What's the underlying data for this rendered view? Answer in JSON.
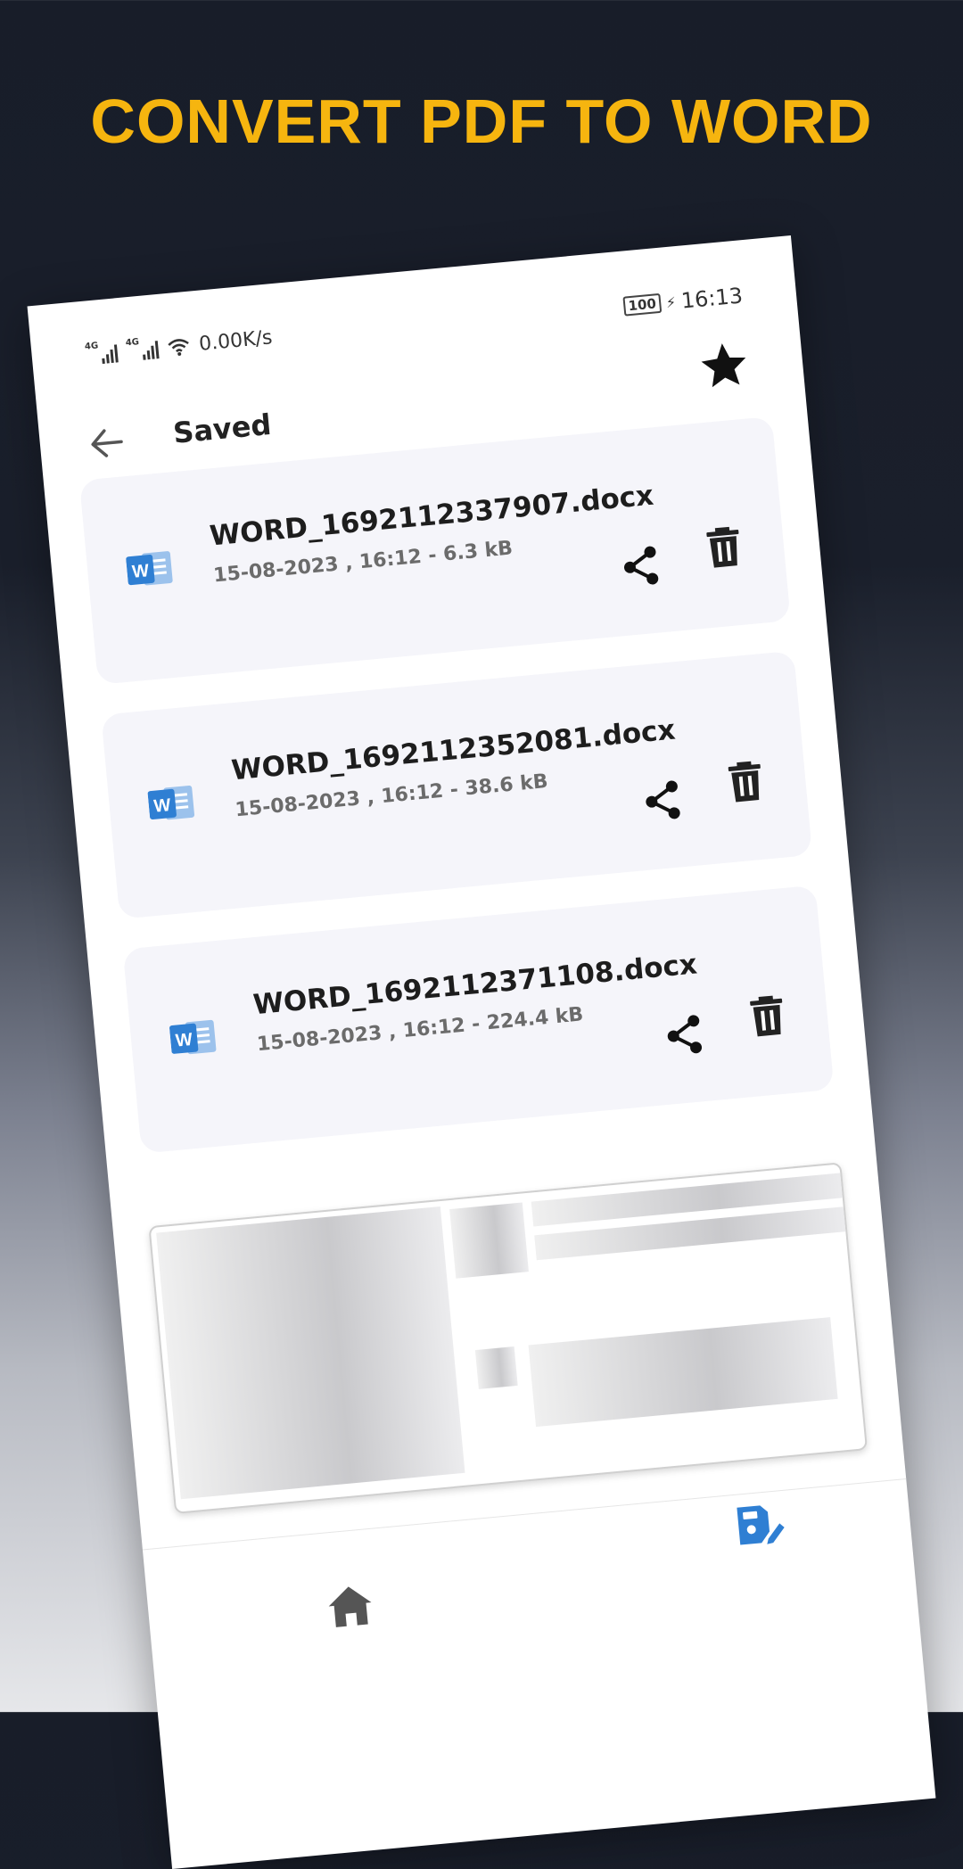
{
  "headline": "CONVERT PDF TO WORD",
  "status_bar": {
    "network_1": "4G",
    "network_2": "4G",
    "speed": "0.00K/s",
    "battery": "100",
    "time": "16:13"
  },
  "header": {
    "title": "Saved"
  },
  "files": [
    {
      "name": "WORD_1692112337907.docx",
      "meta": "15-08-2023 , 16:12 - 6.3 kB"
    },
    {
      "name": "WORD_1692112352081.docx",
      "meta": "15-08-2023 , 16:12 - 38.6 kB"
    },
    {
      "name": "WORD_1692112371108.docx",
      "meta": "15-08-2023 , 16:12 - 224.4 kB"
    }
  ],
  "icons": {
    "back": "arrow-left-icon",
    "favorite": "star-icon",
    "file": "word-icon",
    "share": "share-icon",
    "delete": "trash-icon",
    "home": "home-icon",
    "edit": "edit-document-icon"
  },
  "colors": {
    "accent": "#f6b50f",
    "word_blue": "#2f7fd3",
    "card_bg": "#f5f5fa",
    "nav_active": "#2f7fd3"
  }
}
